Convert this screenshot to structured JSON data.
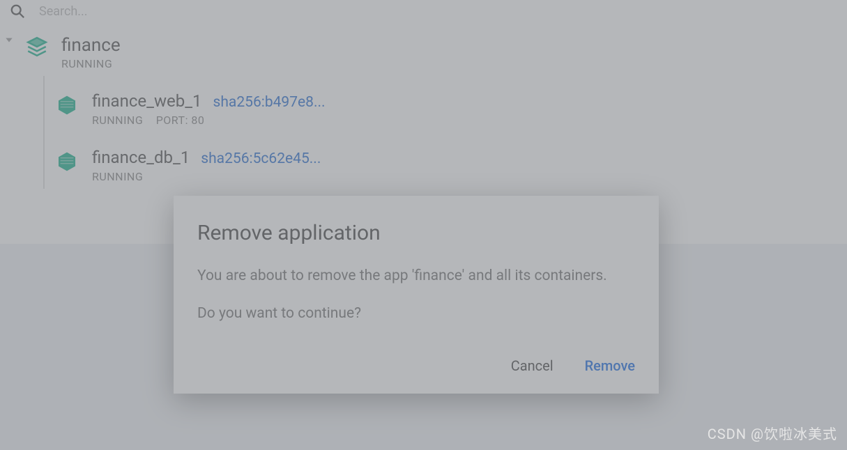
{
  "search": {
    "placeholder": "Search..."
  },
  "stack": {
    "name": "finance",
    "status": "RUNNING",
    "containers": [
      {
        "name": "finance_web_1",
        "sha": "sha256:b497e8...",
        "status": "RUNNING",
        "port_label": "PORT: 80"
      },
      {
        "name": "finance_db_1",
        "sha": "sha256:5c62e45...",
        "status": "RUNNING",
        "port_label": ""
      }
    ]
  },
  "dialog": {
    "title": "Remove application",
    "line1": "You are about to remove the app 'finance' and all its containers.",
    "line2": "Do you want to continue?",
    "cancel": "Cancel",
    "remove": "Remove"
  },
  "watermark": "CSDN @饮啦冰美式"
}
